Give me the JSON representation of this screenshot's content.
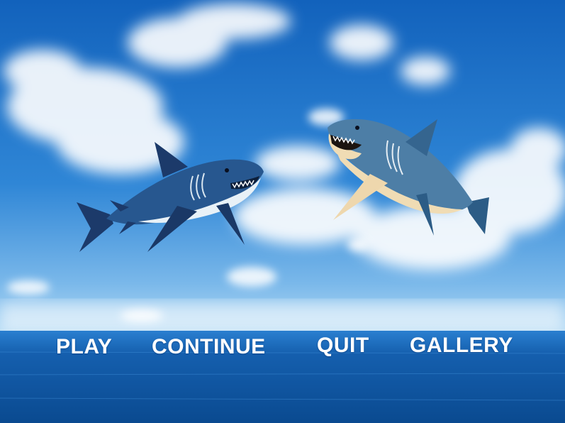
{
  "menu": {
    "play_label": "PLAY",
    "continue_label": "CONTINUE",
    "quit_label": "QUIT",
    "gallery_label": "GALLERY"
  },
  "scene": {
    "background": "sky-and-ocean",
    "sharks": [
      {
        "name": "great-white-shark-left",
        "facing": "right",
        "style": "dark-blue"
      },
      {
        "name": "great-white-shark-right",
        "facing": "left",
        "style": "blue-gray-with-tan-belly"
      }
    ]
  },
  "colors": {
    "sky_top": "#1466c0",
    "sky_horizon": "#8ec4ee",
    "sea": "#0a4e98",
    "text": "#ffffff"
  }
}
